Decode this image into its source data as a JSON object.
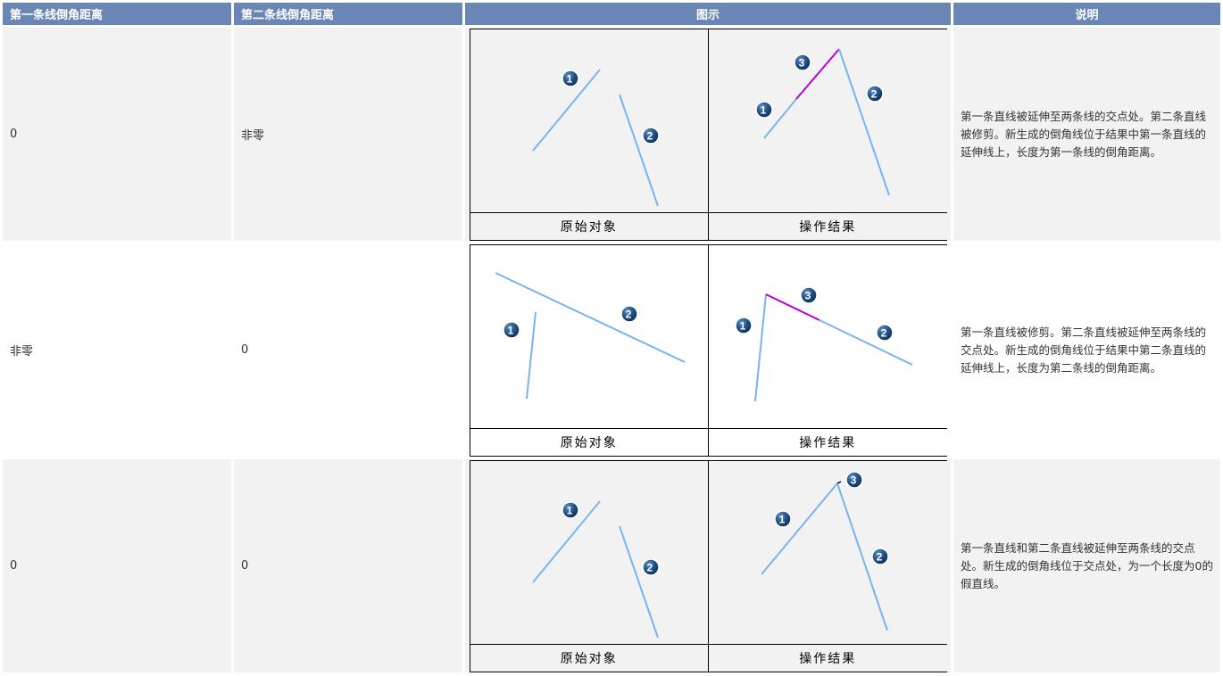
{
  "header": {
    "col1": "第一条线倒角距离",
    "col2": "第二条线倒角距离",
    "col3": "图示",
    "col4": "说明"
  },
  "rows": [
    {
      "first": "0",
      "second": "非零",
      "cap_left": "原始对象",
      "cap_right": "操作结果",
      "desc": "第一条直线被延伸至两条线的交点处。第二条直线被修剪。新生成的倒角线位于结果中第一条直线的延伸线上，长度为第一条线的倒角距离。"
    },
    {
      "first": "非零",
      "second": "0",
      "cap_left": "原始对象",
      "cap_right": "操作结果",
      "desc": "第一条直线被修剪。第二条直线被延伸至两条线的交点处。新生成的倒角线位于结果中第二条直线的延伸线上，长度为第二条线的倒角距离。"
    },
    {
      "first": "0",
      "second": "0",
      "cap_left": "原始对象",
      "cap_right": "操作结果",
      "desc": "第一条直线和第二条直线被延伸至两条线的交点处。新生成的倒角线位于交点处，为一个长度为0的假直线。"
    }
  ],
  "markers": {
    "one": "1",
    "two": "2",
    "three": "3"
  },
  "colors": {
    "line": "#7ab4f0",
    "chamfer": "#b400d8",
    "marker": "#1c4e84",
    "header": "#6a86b4"
  }
}
